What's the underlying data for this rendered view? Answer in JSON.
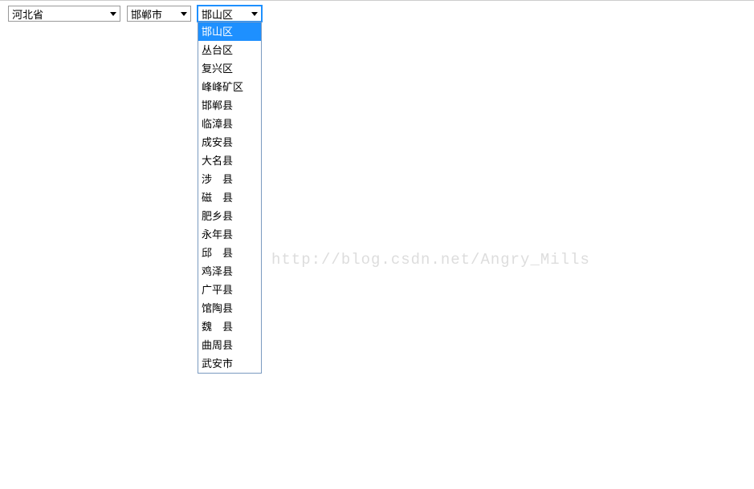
{
  "province": {
    "selected": "河北省"
  },
  "city": {
    "selected": "邯郸市"
  },
  "district": {
    "selected": "邯山区",
    "options": [
      "邯山区",
      "丛台区",
      "复兴区",
      "峰峰矿区",
      "邯郸县",
      "临漳县",
      "成安县",
      "大名县",
      "涉　县",
      "磁　县",
      "肥乡县",
      "永年县",
      "邱　县",
      "鸡泽县",
      "广平县",
      "馆陶县",
      "魏　县",
      "曲周县",
      "武安市"
    ],
    "highlighted_index": 0
  },
  "watermark": "http://blog.csdn.net/Angry_Mills"
}
